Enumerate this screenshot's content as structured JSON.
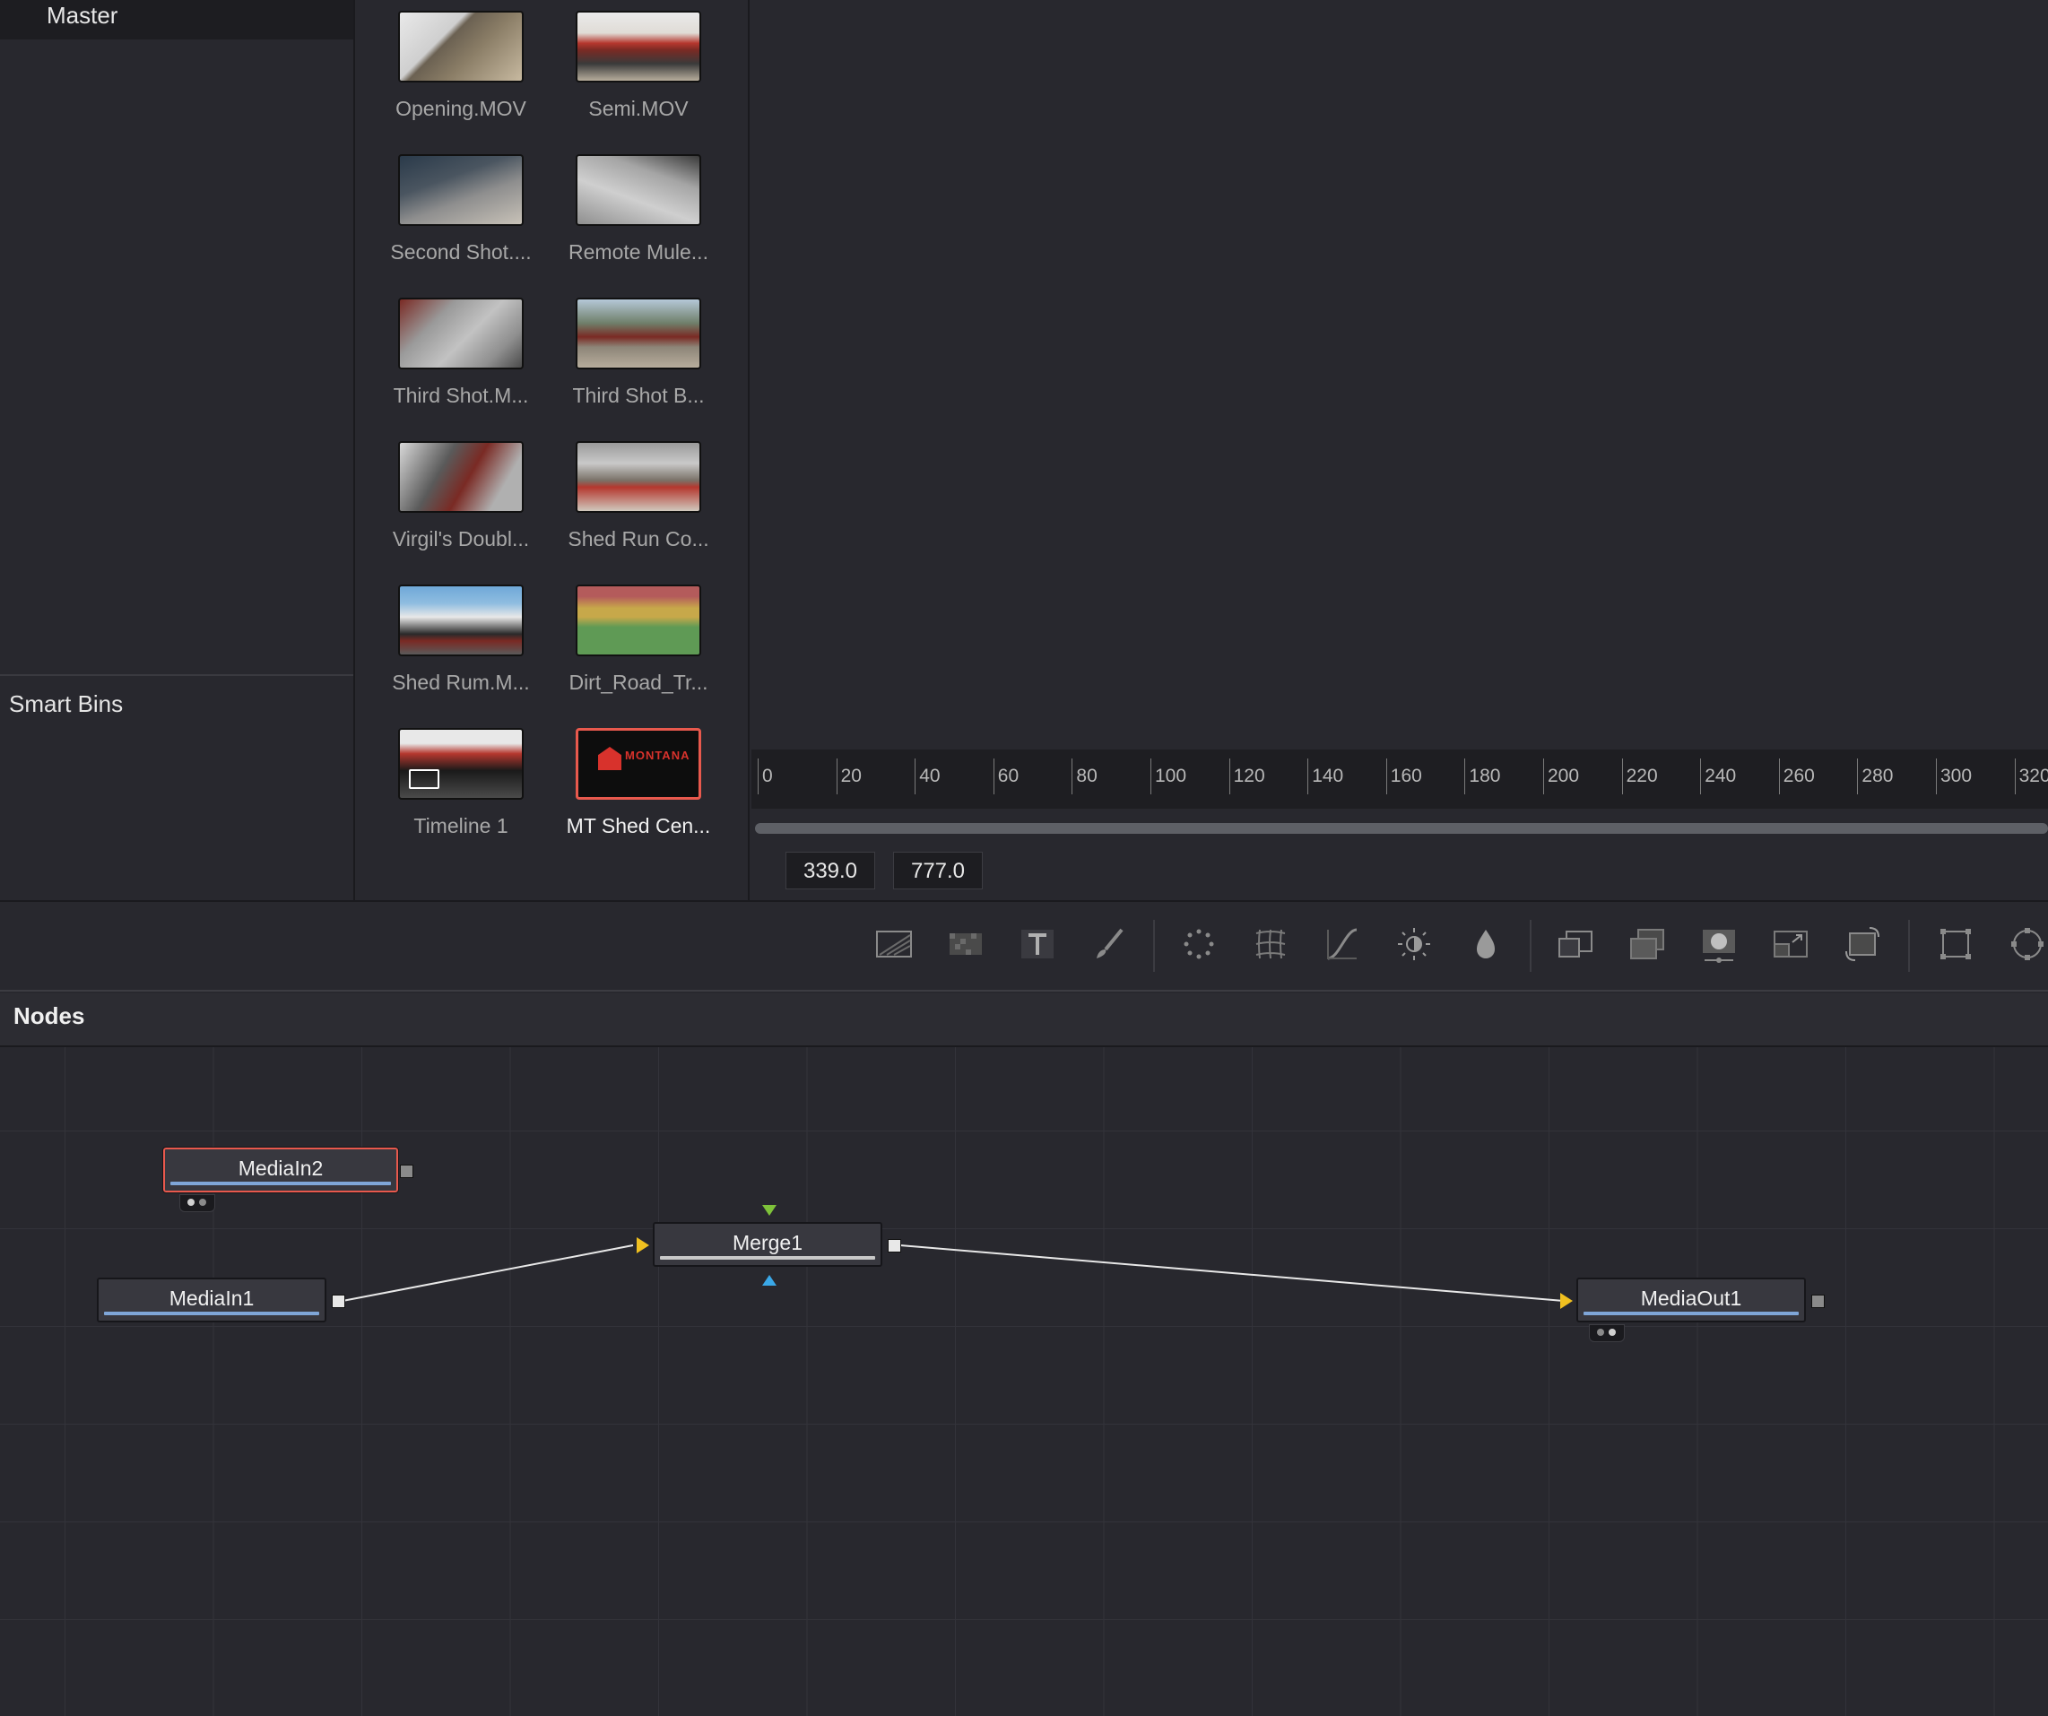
{
  "bins": {
    "master_label": "Master",
    "smart_bins_label": "Smart Bins"
  },
  "media_pool": {
    "clips": [
      {
        "name": "Opening.MOV",
        "thumb": "aerial-lot"
      },
      {
        "name": "Semi.MOV",
        "thumb": "sheds-red"
      },
      {
        "name": "Second Shot....",
        "thumb": "aerial-lot"
      },
      {
        "name": "Remote Mule...",
        "thumb": "aerial-lot"
      },
      {
        "name": "Third Shot.M...",
        "thumb": "aerial-lot"
      },
      {
        "name": "Third Shot B...",
        "thumb": "mountains"
      },
      {
        "name": "Virgil's Doubl...",
        "thumb": "aerial-lot"
      },
      {
        "name": "Shed Run Co...",
        "thumb": "aerial-lot"
      },
      {
        "name": "Shed Rum.M...",
        "thumb": "mountains"
      },
      {
        "name": "Dirt_Road_Tr...",
        "thumb": "color-bars"
      },
      {
        "name": "Timeline 1",
        "thumb": "timeline"
      },
      {
        "name": "MT Shed Cen...",
        "thumb": "montana-logo",
        "selected": true
      }
    ],
    "logo_text": "MONTANA"
  },
  "ruler": {
    "ticks": [
      "0",
      "20",
      "40",
      "60",
      "80",
      "100",
      "120",
      "140",
      "160",
      "180",
      "200",
      "220",
      "240",
      "260",
      "280",
      "300",
      "320"
    ]
  },
  "coords": {
    "x": "339.0",
    "y": "777.0"
  },
  "toolbar": {
    "tools": [
      "background-icon",
      "fast-noise-icon",
      "text-icon",
      "paint-icon",
      "particles-icon",
      "grid-warp-icon",
      "color-curves-icon",
      "brightness-contrast-icon",
      "blur-icon",
      "merge-tool-icon",
      "matte-control-icon",
      "mask-icon",
      "resize-icon",
      "transform-icon",
      "rectangle-mask-icon",
      "ellipse-mask-icon"
    ]
  },
  "nodes": {
    "title": "Nodes",
    "items": {
      "mediain2": "MediaIn2",
      "mediain1": "MediaIn1",
      "merge1": "Merge1",
      "mediaout1": "MediaOut1"
    }
  },
  "colors": {
    "selection": "#e8594d",
    "foreground_input": "#7ec23a",
    "mask_input": "#3aa8e8",
    "background_input": "#f0c020",
    "node_bar": "#7fa6d8"
  }
}
